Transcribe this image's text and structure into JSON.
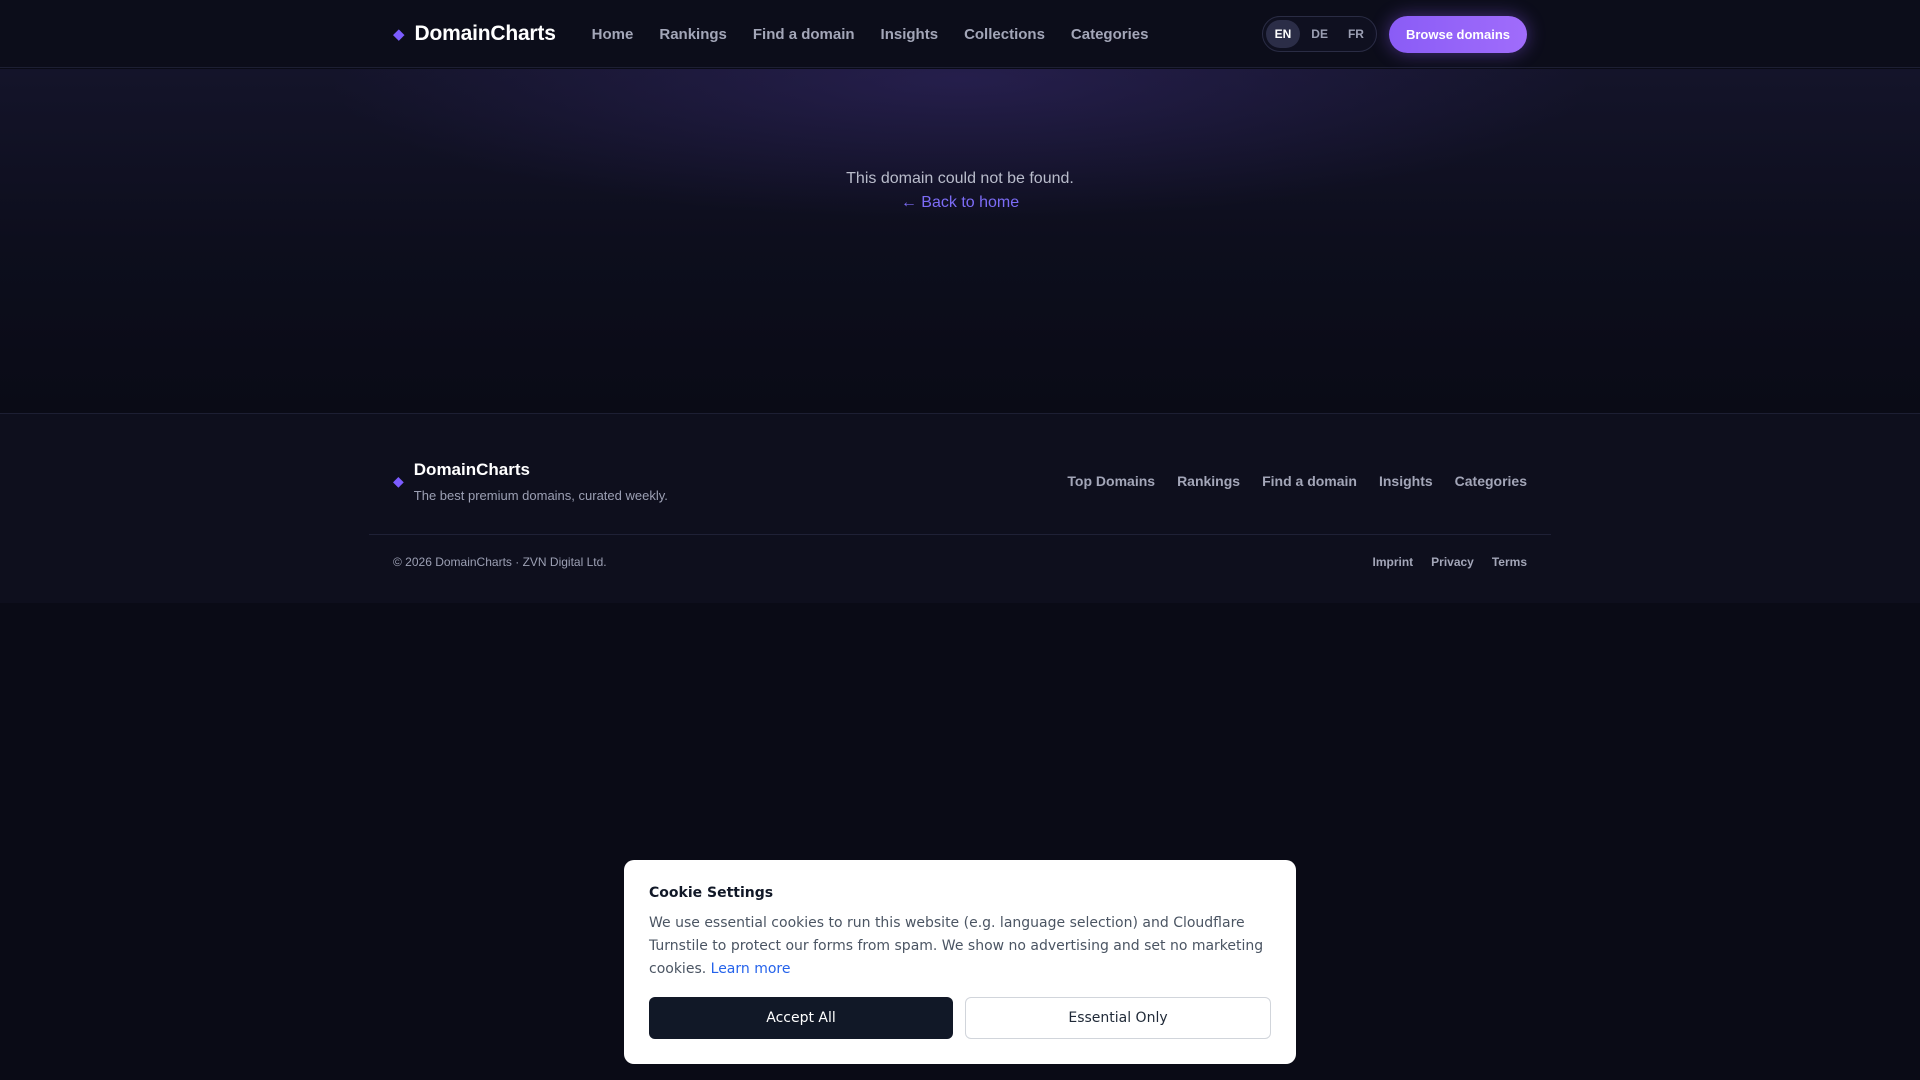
{
  "brand": {
    "name": "DomainCharts",
    "icon": "diamond-icon",
    "accent": "#7c5cff"
  },
  "nav": {
    "items": [
      {
        "label": "Home"
      },
      {
        "label": "Rankings"
      },
      {
        "label": "Find a domain"
      },
      {
        "label": "Insights"
      },
      {
        "label": "Collections"
      },
      {
        "label": "Categories"
      }
    ]
  },
  "languages": {
    "items": [
      {
        "label": "EN",
        "active": true
      },
      {
        "label": "DE",
        "active": false
      },
      {
        "label": "FR",
        "active": false
      }
    ]
  },
  "header": {
    "cta_label": "Browse domains"
  },
  "main": {
    "message": "This domain could not be found.",
    "back_link": "← Back to home"
  },
  "footer": {
    "brand_name": "DomainCharts",
    "tagline": "The best premium domains, curated weekly.",
    "links": [
      {
        "label": "Top Domains"
      },
      {
        "label": "Rankings"
      },
      {
        "label": "Find a domain"
      },
      {
        "label": "Insights"
      },
      {
        "label": "Categories"
      }
    ],
    "copyright": "© 2026 DomainCharts · ZVN Digital Ltd.",
    "legal": [
      {
        "label": "Imprint"
      },
      {
        "label": "Privacy"
      },
      {
        "label": "Terms"
      }
    ]
  },
  "cookie": {
    "title": "Cookie Settings",
    "text": "We use essential cookies to run this website (e.g. language selection) and Cloudflare Turnstile to protect our forms from spam. We show no advertising and set no marketing cookies.",
    "learn_more": "Learn more",
    "accept_label": "Accept All",
    "essential_label": "Essential Only"
  }
}
